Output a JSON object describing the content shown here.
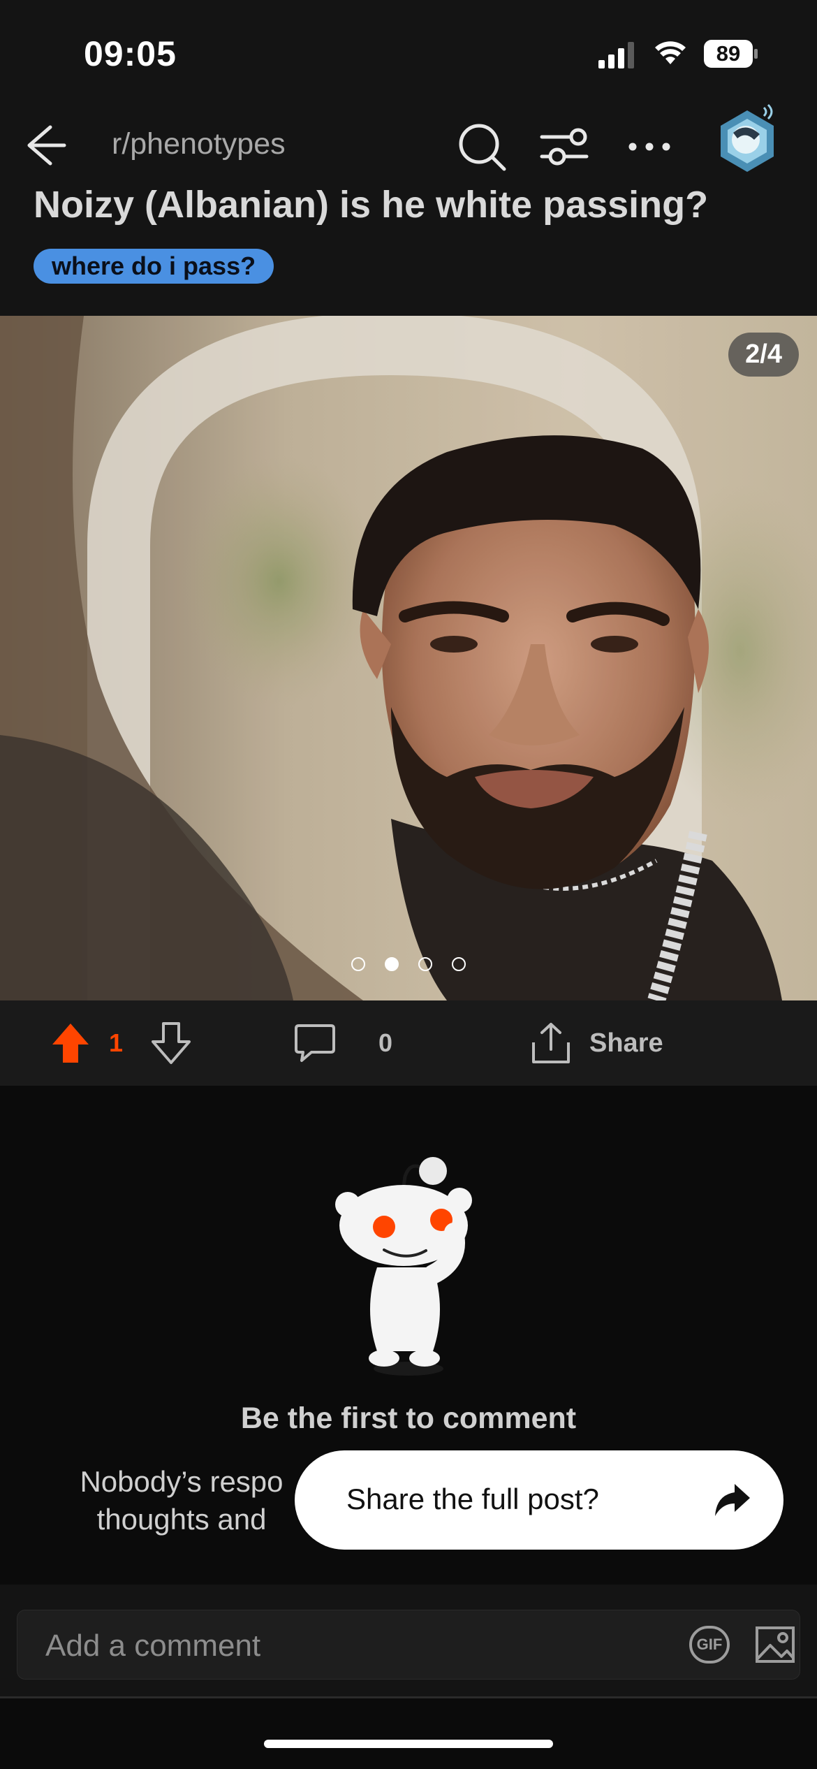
{
  "status_bar": {
    "time": "09:05",
    "battery": "89"
  },
  "nav": {
    "subreddit": "r/phenotypes"
  },
  "post": {
    "title": "Noizy (Albanian) is he white passing?",
    "flair": "where do i pass?",
    "media_counter": "2/4",
    "media_total": 4,
    "media_current": 2
  },
  "actions": {
    "upvotes": "1",
    "comments": "0",
    "share_label": "Share"
  },
  "comments_empty": {
    "headline": "Be the first to comment",
    "line1": "Nobody’s respo",
    "line2": "thoughts and"
  },
  "toast": {
    "text": "Share the full post?"
  },
  "composer": {
    "placeholder": "Add a comment",
    "gif_label": "GIF"
  },
  "colors": {
    "upvote": "#ff4500",
    "flair": "#4a90e2",
    "background": "#0b0b0b"
  }
}
